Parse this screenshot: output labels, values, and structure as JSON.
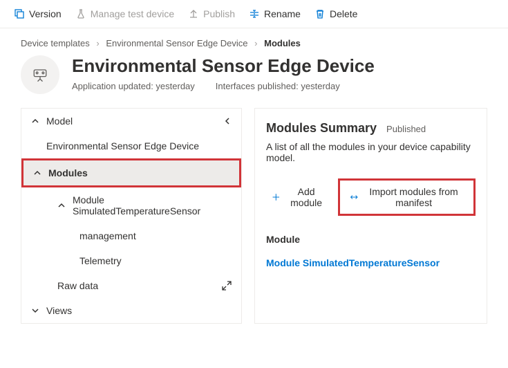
{
  "toolbar": {
    "version": "Version",
    "manage_test_device": "Manage test device",
    "publish": "Publish",
    "rename": "Rename",
    "delete": "Delete"
  },
  "breadcrumbs": {
    "items": [
      "Device templates",
      "Environmental Sensor Edge Device",
      "Modules"
    ]
  },
  "header": {
    "title": "Environmental Sensor Edge Device",
    "app_updated": "Application updated: yesterday",
    "interfaces_published": "Interfaces published: yesterday"
  },
  "tree": {
    "model": "Model",
    "device_name": "Environmental Sensor Edge Device",
    "modules": "Modules",
    "module_item": "Module SimulatedTemperatureSensor",
    "management": "management",
    "telemetry": "Telemetry",
    "raw_data": "Raw data",
    "views": "Views"
  },
  "summary": {
    "title": "Modules Summary",
    "status": "Published",
    "desc": "A list of all the modules in your device capability model.",
    "add_module": "Add module",
    "import_modules": "Import modules from manifest",
    "section": "Module",
    "module_link": "Module SimulatedTemperatureSensor"
  }
}
